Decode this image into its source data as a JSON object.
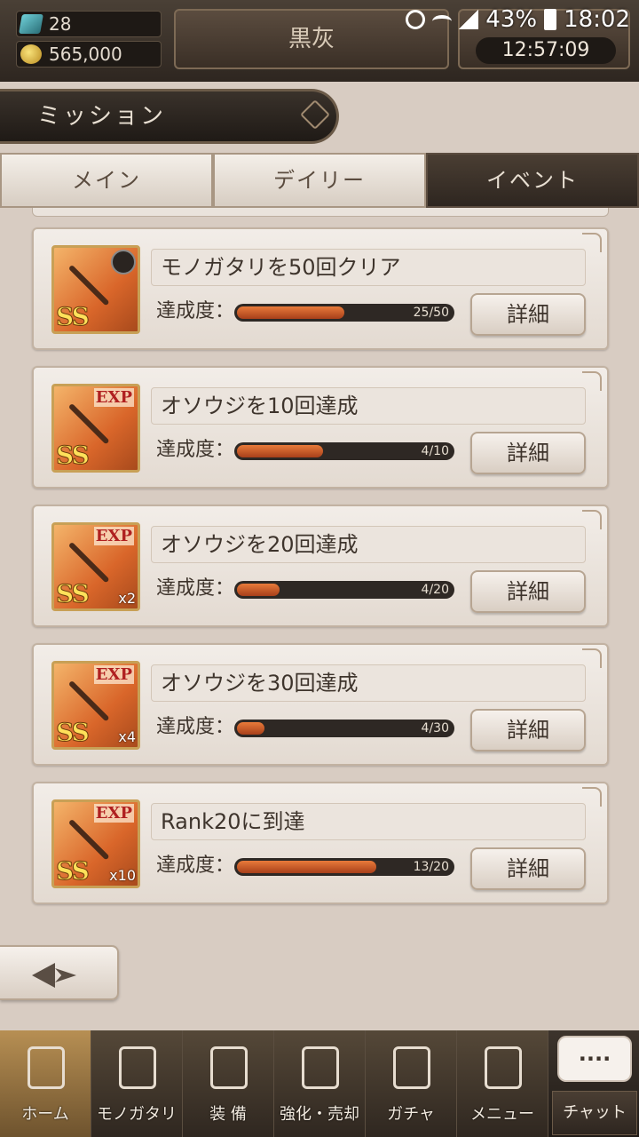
{
  "status_bar": {
    "battery": "43%",
    "time": "18:02"
  },
  "header": {
    "gems": "28",
    "coins": "565,000",
    "player_name": "黒灰",
    "timer": "12:57:09"
  },
  "mission_title": "ミッション",
  "tabs": [
    {
      "label": "メイン",
      "active": false
    },
    {
      "label": "デイリー",
      "active": false
    },
    {
      "label": "イベント",
      "active": true
    }
  ],
  "missions": [
    {
      "name": "モノガタリを50回クリア",
      "progress_label": "達成度：",
      "progress_text": "25/50",
      "progress": 0.5,
      "detail": "詳細",
      "icon": "axe-weapon-icon",
      "badge": "",
      "qty": ""
    },
    {
      "name": "オソウジを10回達成",
      "progress_label": "達成度：",
      "progress_text": "4/10",
      "progress": 0.4,
      "detail": "詳細",
      "icon": "exp-sword-icon",
      "badge": "EXP",
      "qty": ""
    },
    {
      "name": "オソウジを20回達成",
      "progress_label": "達成度：",
      "progress_text": "4/20",
      "progress": 0.2,
      "detail": "詳細",
      "icon": "exp-sword-icon",
      "badge": "EXP",
      "qty": "x2"
    },
    {
      "name": "オソウジを30回達成",
      "progress_label": "達成度：",
      "progress_text": "4/30",
      "progress": 0.13,
      "detail": "詳細",
      "icon": "exp-sword-icon",
      "badge": "EXP",
      "qty": "x4"
    },
    {
      "name": "Rank20に到達",
      "progress_label": "達成度：",
      "progress_text": "13/20",
      "progress": 0.65,
      "detail": "詳細",
      "icon": "exp-sword-icon",
      "badge": "EXP",
      "qty": "x10"
    }
  ],
  "rarity": "SS",
  "bottom_nav": [
    {
      "label": "ホーム",
      "icon": "castle-icon",
      "active": true
    },
    {
      "label": "モノガタリ",
      "icon": "book-icon",
      "active": false
    },
    {
      "label": "装 備",
      "icon": "puppet-icon",
      "active": false
    },
    {
      "label": "強化・売却",
      "icon": "helmet-icon",
      "active": false
    },
    {
      "label": "ガチャ",
      "icon": "crossed-swords-icon",
      "active": false
    },
    {
      "label": "メニュー",
      "icon": "gears-icon",
      "active": false
    }
  ],
  "chat": {
    "bubble": "....",
    "label": "チャット"
  }
}
